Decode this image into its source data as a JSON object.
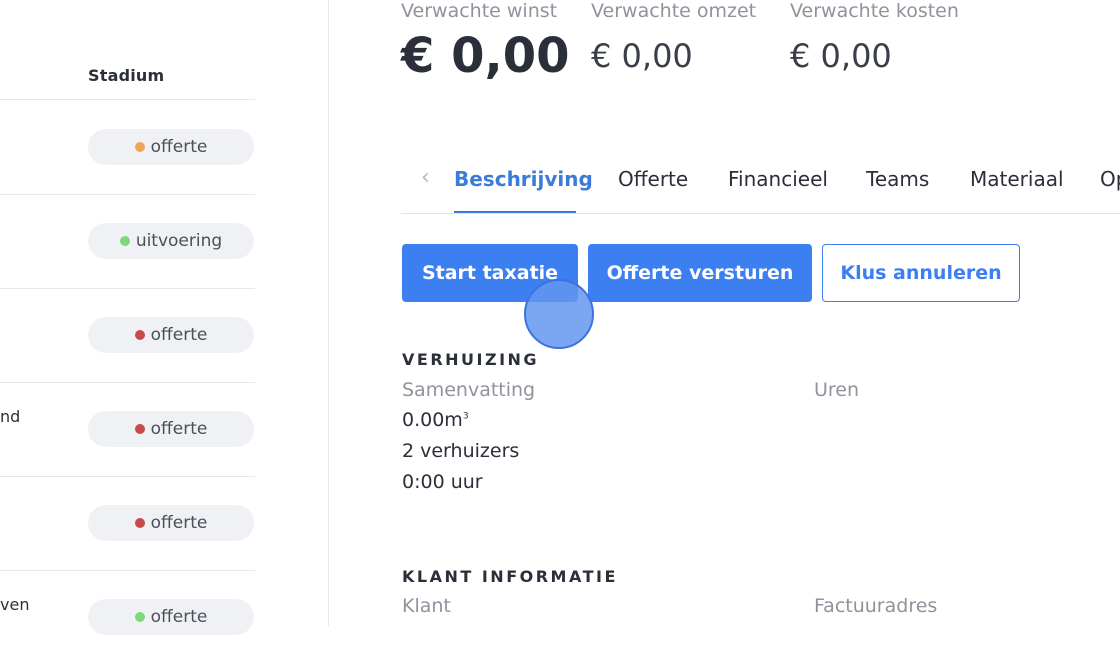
{
  "list": {
    "column_header": "Stadium",
    "rows": [
      {
        "name": "",
        "status": "offerte",
        "dot_color": "#f2a45a"
      },
      {
        "name": "",
        "status": "uitvoering",
        "dot_color": "#7dd87a"
      },
      {
        "name": "",
        "status": "offerte",
        "dot_color": "#c84a4a"
      },
      {
        "name": "nd",
        "status": "offerte",
        "dot_color": "#c84a4a"
      },
      {
        "name": "",
        "status": "offerte",
        "dot_color": "#c84a4a"
      },
      {
        "name": "ven",
        "status": "offerte",
        "dot_color": "#7dd87a"
      }
    ]
  },
  "metrics": {
    "winst_label": "Verwachte winst",
    "winst_value": "€ 0,00",
    "omzet_label": "Verwachte omzet",
    "omzet_value": "€ 0,00",
    "kosten_label": "Verwachte kosten",
    "kosten_value": "€ 0,00"
  },
  "tabs": {
    "items": [
      "Beschrijving",
      "Offerte",
      "Financieel",
      "Teams",
      "Materiaal",
      "Op"
    ],
    "active": "Beschrijving"
  },
  "actions": {
    "start_taxatie": "Start taxatie",
    "offerte_versturen": "Offerte versturen",
    "klus_annuleren": "Klus annuleren"
  },
  "verhuizing": {
    "title": "VERHUIZING",
    "samenvatting_label": "Samenvatting",
    "uren_label": "Uren",
    "volume": "0.00m",
    "volume_sup": "3",
    "verhuizers": "2 verhuizers",
    "duur": "0:00 uur"
  },
  "klant": {
    "title": "KLANT INFORMATIE",
    "klant_label": "Klant",
    "factuuradres_label": "Factuuradres"
  },
  "colors": {
    "accent": "#3b7ff0",
    "tab_active": "#3a7bdc"
  }
}
